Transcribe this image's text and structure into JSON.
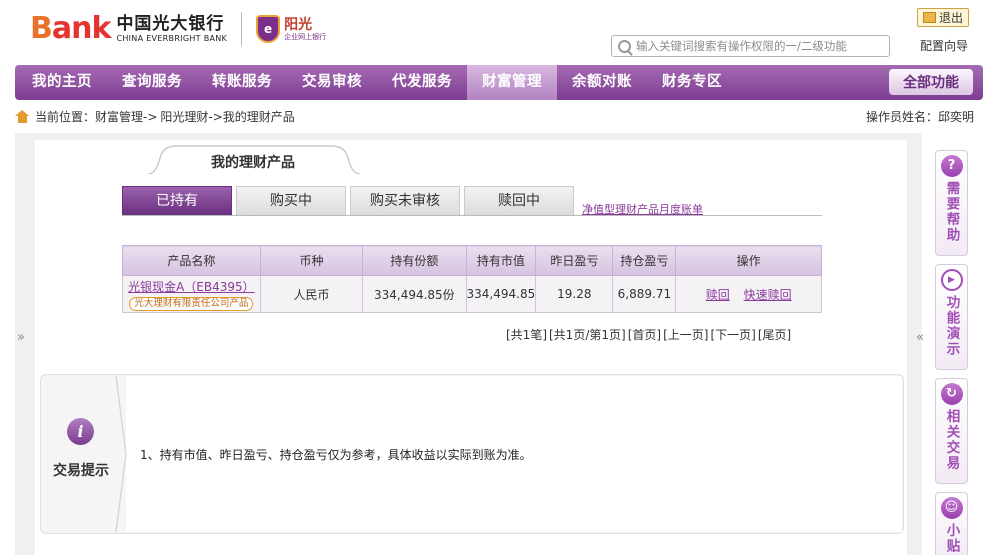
{
  "header": {
    "logo_bank": "Bank",
    "logo_bank_initial": "B",
    "logo_bank_rest": "ank",
    "logo_cn": "中国光大银行",
    "logo_en": "CHINA EVERBRIGHT BANK",
    "sub_logo_title": "阳光",
    "sub_logo_subtitle": "企业网上银行",
    "logout_label": "退出",
    "search_placeholder": "输入关键词搜索有操作权限的一/二级功能",
    "config_label": "配置向导"
  },
  "nav": {
    "items": [
      {
        "label": "我的主页"
      },
      {
        "label": "查询服务"
      },
      {
        "label": "转账服务"
      },
      {
        "label": "交易审核"
      },
      {
        "label": "代发服务"
      },
      {
        "label": "财富管理"
      },
      {
        "label": "余额对账"
      },
      {
        "label": "财务专区"
      }
    ],
    "active_index": 5,
    "all_functions_label": "全部功能"
  },
  "breadcrumb": {
    "prefix": "当前位置：",
    "level1": "财富管理->",
    "level2": "阳光理财->",
    "level3": "我的理财产品"
  },
  "operator": "操作员姓名：邱奕明",
  "page_title": "我的理财产品",
  "tabs": [
    {
      "label": "已持有"
    },
    {
      "label": "购买中"
    },
    {
      "label": "购买未审核"
    },
    {
      "label": "赎回中"
    }
  ],
  "active_tab": 0,
  "monthly_statement_link": "净值型理财产品月度账单",
  "table": {
    "headers": [
      "产品名称",
      "币种",
      "持有份额",
      "持有市值",
      "昨日盈亏",
      "持仓盈亏",
      "操作"
    ],
    "rows": [
      {
        "product_name": "光银现金A（EB4395）",
        "product_tag": "光大理财有限责任公司产品",
        "currency": "人民币",
        "shares": "334,494.85份",
        "market_value": "334,494.85",
        "yesterday_pl": "19.28",
        "position_pl": "6,889.71",
        "action_redeem": "赎回",
        "action_quick_redeem": "快速赎回"
      }
    ]
  },
  "pager": {
    "total": "[共1笔]",
    "pages": "[共1页/第1页]",
    "first": "[首页]",
    "prev": "[上一页]",
    "next": "[下一页]",
    "last": "[尾页]"
  },
  "tips": {
    "title": "交易提示",
    "icon_glyph": "i",
    "text": "1、持有市值、昨日盈亏、持仓盈亏仅为参考，具体收益以实际到账为准。"
  },
  "sidebar": {
    "items": [
      {
        "label": "需要帮助",
        "icon": "question-icon",
        "glyph": "?"
      },
      {
        "label": "功能演示",
        "icon": "play-icon",
        "glyph": "▶"
      },
      {
        "label": "相关交易",
        "icon": "refresh-icon",
        "glyph": "↻"
      },
      {
        "label": "小贴",
        "icon": "smile-icon",
        "glyph": "☺"
      }
    ]
  },
  "arrows": {
    "left": "»",
    "right": "«"
  }
}
